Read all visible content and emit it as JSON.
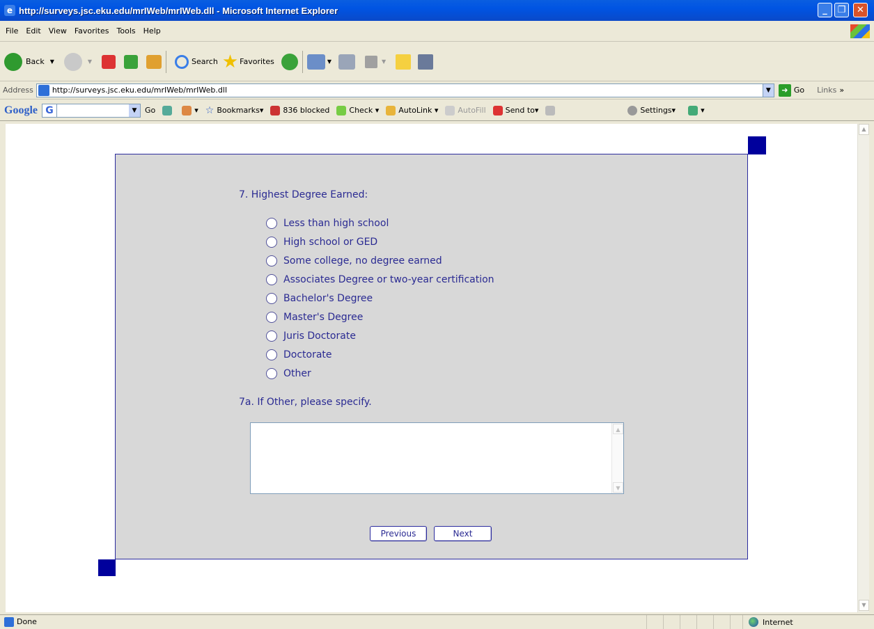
{
  "window": {
    "title": "http://surveys.jsc.eku.edu/mrIWeb/mrIWeb.dll - Microsoft Internet Explorer"
  },
  "menu": [
    "File",
    "Edit",
    "View",
    "Favorites",
    "Tools",
    "Help"
  ],
  "toolbar": {
    "back": "Back",
    "search": "Search",
    "favorites": "Favorites"
  },
  "address": {
    "label": "Address",
    "url": "http://surveys.jsc.eku.edu/mrIWeb/mrIWeb.dll",
    "go": "Go",
    "links": "Links"
  },
  "google": {
    "logo": "Google",
    "go": "Go",
    "bookmarks": "Bookmarks",
    "blocked": "836 blocked",
    "check": "Check",
    "autolink": "AutoLink",
    "autofill": "AutoFill",
    "sendto": "Send to",
    "settings": "Settings"
  },
  "survey": {
    "question": "7. Highest Degree Earned:",
    "options": [
      "Less than high school",
      "High school or GED",
      "Some college, no degree earned",
      "Associates Degree or two-year certification",
      "Bachelor's Degree",
      "Master's Degree",
      "Juris Doctorate",
      "Doctorate",
      "Other"
    ],
    "followup": "7a. If Other, please specify.",
    "other_text": "",
    "previous": "Previous",
    "next": "Next"
  },
  "status": {
    "text": "Done",
    "zone": "Internet"
  },
  "colors": {
    "accent": "#00009c",
    "text": "#2a2a92",
    "panel": "#d8d8d8"
  }
}
